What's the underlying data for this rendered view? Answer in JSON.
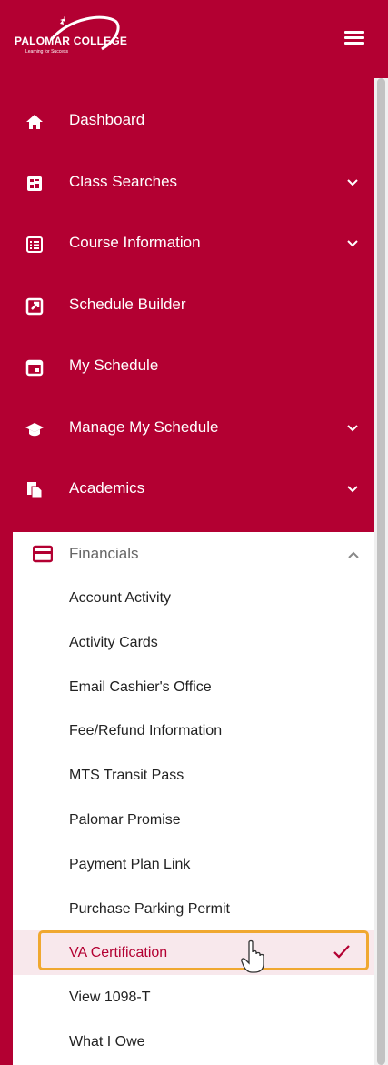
{
  "brand": {
    "name": "PALOMAR COLLEGE",
    "tagline": "Learning for Success"
  },
  "colors": {
    "primary": "#b30032",
    "panel_bg": "#ffffff",
    "highlight": "#f0a830",
    "selected_bg": "#f8e8ec"
  },
  "nav": {
    "items": [
      {
        "label": "Dashboard",
        "icon": "home-icon",
        "expandable": false
      },
      {
        "label": "Class Searches",
        "icon": "search-card-icon",
        "expandable": true
      },
      {
        "label": "Course Information",
        "icon": "list-icon",
        "expandable": true
      },
      {
        "label": "Schedule Builder",
        "icon": "external-link-icon",
        "expandable": false
      },
      {
        "label": "My Schedule",
        "icon": "calendar-icon",
        "expandable": false
      },
      {
        "label": "Manage My Schedule",
        "icon": "graduation-cap-icon",
        "expandable": true
      },
      {
        "label": "Academics",
        "icon": "documents-icon",
        "expandable": true
      }
    ],
    "financials": {
      "label": "Financials",
      "icon": "credit-card-icon",
      "expanded": true,
      "items": [
        "Account Activity",
        "Activity Cards",
        "Email Cashier's Office",
        "Fee/Refund Information",
        "MTS Transit Pass",
        "Palomar Promise",
        "Payment Plan Link",
        "Purchase Parking Permit",
        "VA Certification",
        "View 1098-T",
        "What I Owe"
      ],
      "selected": "VA Certification"
    }
  }
}
